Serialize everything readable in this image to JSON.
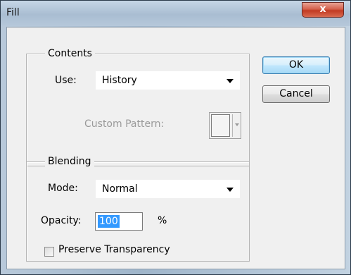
{
  "window": {
    "title": "Fill",
    "close_glyph": "x"
  },
  "contents": {
    "legend": "Contents",
    "use_label": "Use:",
    "use_value": "History",
    "custom_pattern_label": "Custom Pattern:"
  },
  "blending": {
    "legend": "Blending",
    "mode_label": "Mode:",
    "mode_value": "Normal",
    "opacity_label": "Opacity:",
    "opacity_value": "100",
    "opacity_unit": "%",
    "preserve_label": "Preserve Transparency",
    "preserve_checked": false
  },
  "buttons": {
    "ok": "OK",
    "cancel": "Cancel"
  },
  "icons": {
    "close": "close-icon",
    "dropdown": "chevron-down-icon"
  },
  "colors": {
    "selection": "#3399ff",
    "close_button": "#c23a22",
    "dialog_bg": "#f0f0f0"
  }
}
